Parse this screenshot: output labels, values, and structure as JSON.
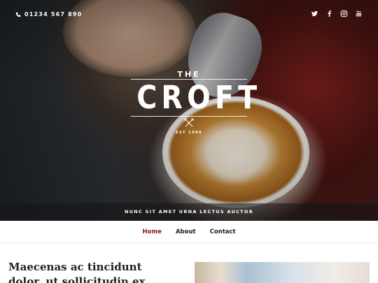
{
  "header": {
    "phone": "01234 567 890",
    "social": [
      "twitter-icon",
      "facebook-icon",
      "instagram-icon",
      "youtube-icon"
    ]
  },
  "logo": {
    "the": "THE",
    "name": "CROFT",
    "est": "EST 1980"
  },
  "hero": {
    "tagline": "NUNC SIT AMET URNA LECTUS AUCTOR"
  },
  "nav": {
    "items": [
      {
        "label": "Home",
        "active": true
      },
      {
        "label": "About",
        "active": false
      },
      {
        "label": "Contact",
        "active": false
      }
    ]
  },
  "post": {
    "title": "Maecenas ac tincidunt dolor, ut sollicitudin ex"
  },
  "colors": {
    "accent": "#8b1a1a",
    "text": "#222222"
  }
}
